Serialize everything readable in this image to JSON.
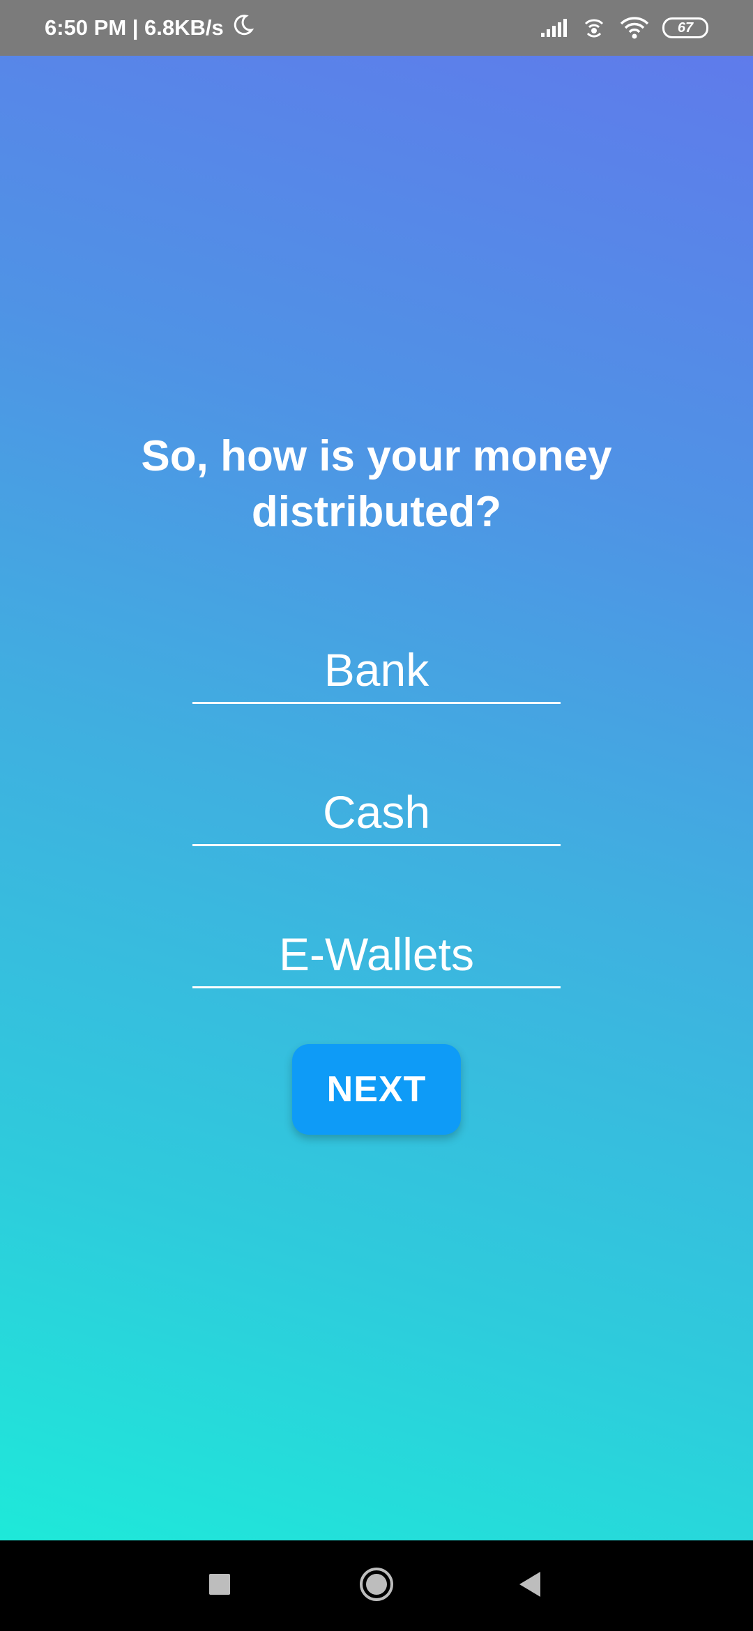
{
  "status_bar": {
    "time_speed": "6:50 PM | 6.8KB/s",
    "battery_level": "67",
    "icons": [
      "moon-icon",
      "signal-icon",
      "hotspot-icon",
      "wifi-icon",
      "battery-icon"
    ]
  },
  "main": {
    "question": "So, how is your money distributed?",
    "fields": {
      "bank_placeholder": "Bank",
      "cash_placeholder": "Cash",
      "ewallets_placeholder": "E-Wallets"
    },
    "next_label": "NEXT"
  },
  "nav_bar": {
    "icons": [
      "recents-icon",
      "home-icon",
      "back-icon"
    ]
  },
  "colors": {
    "gradient_top": "#5f7beb",
    "gradient_bottom": "#1ee9d9",
    "button": "#0e9bf7",
    "status_bar": "#7b7b7b"
  }
}
